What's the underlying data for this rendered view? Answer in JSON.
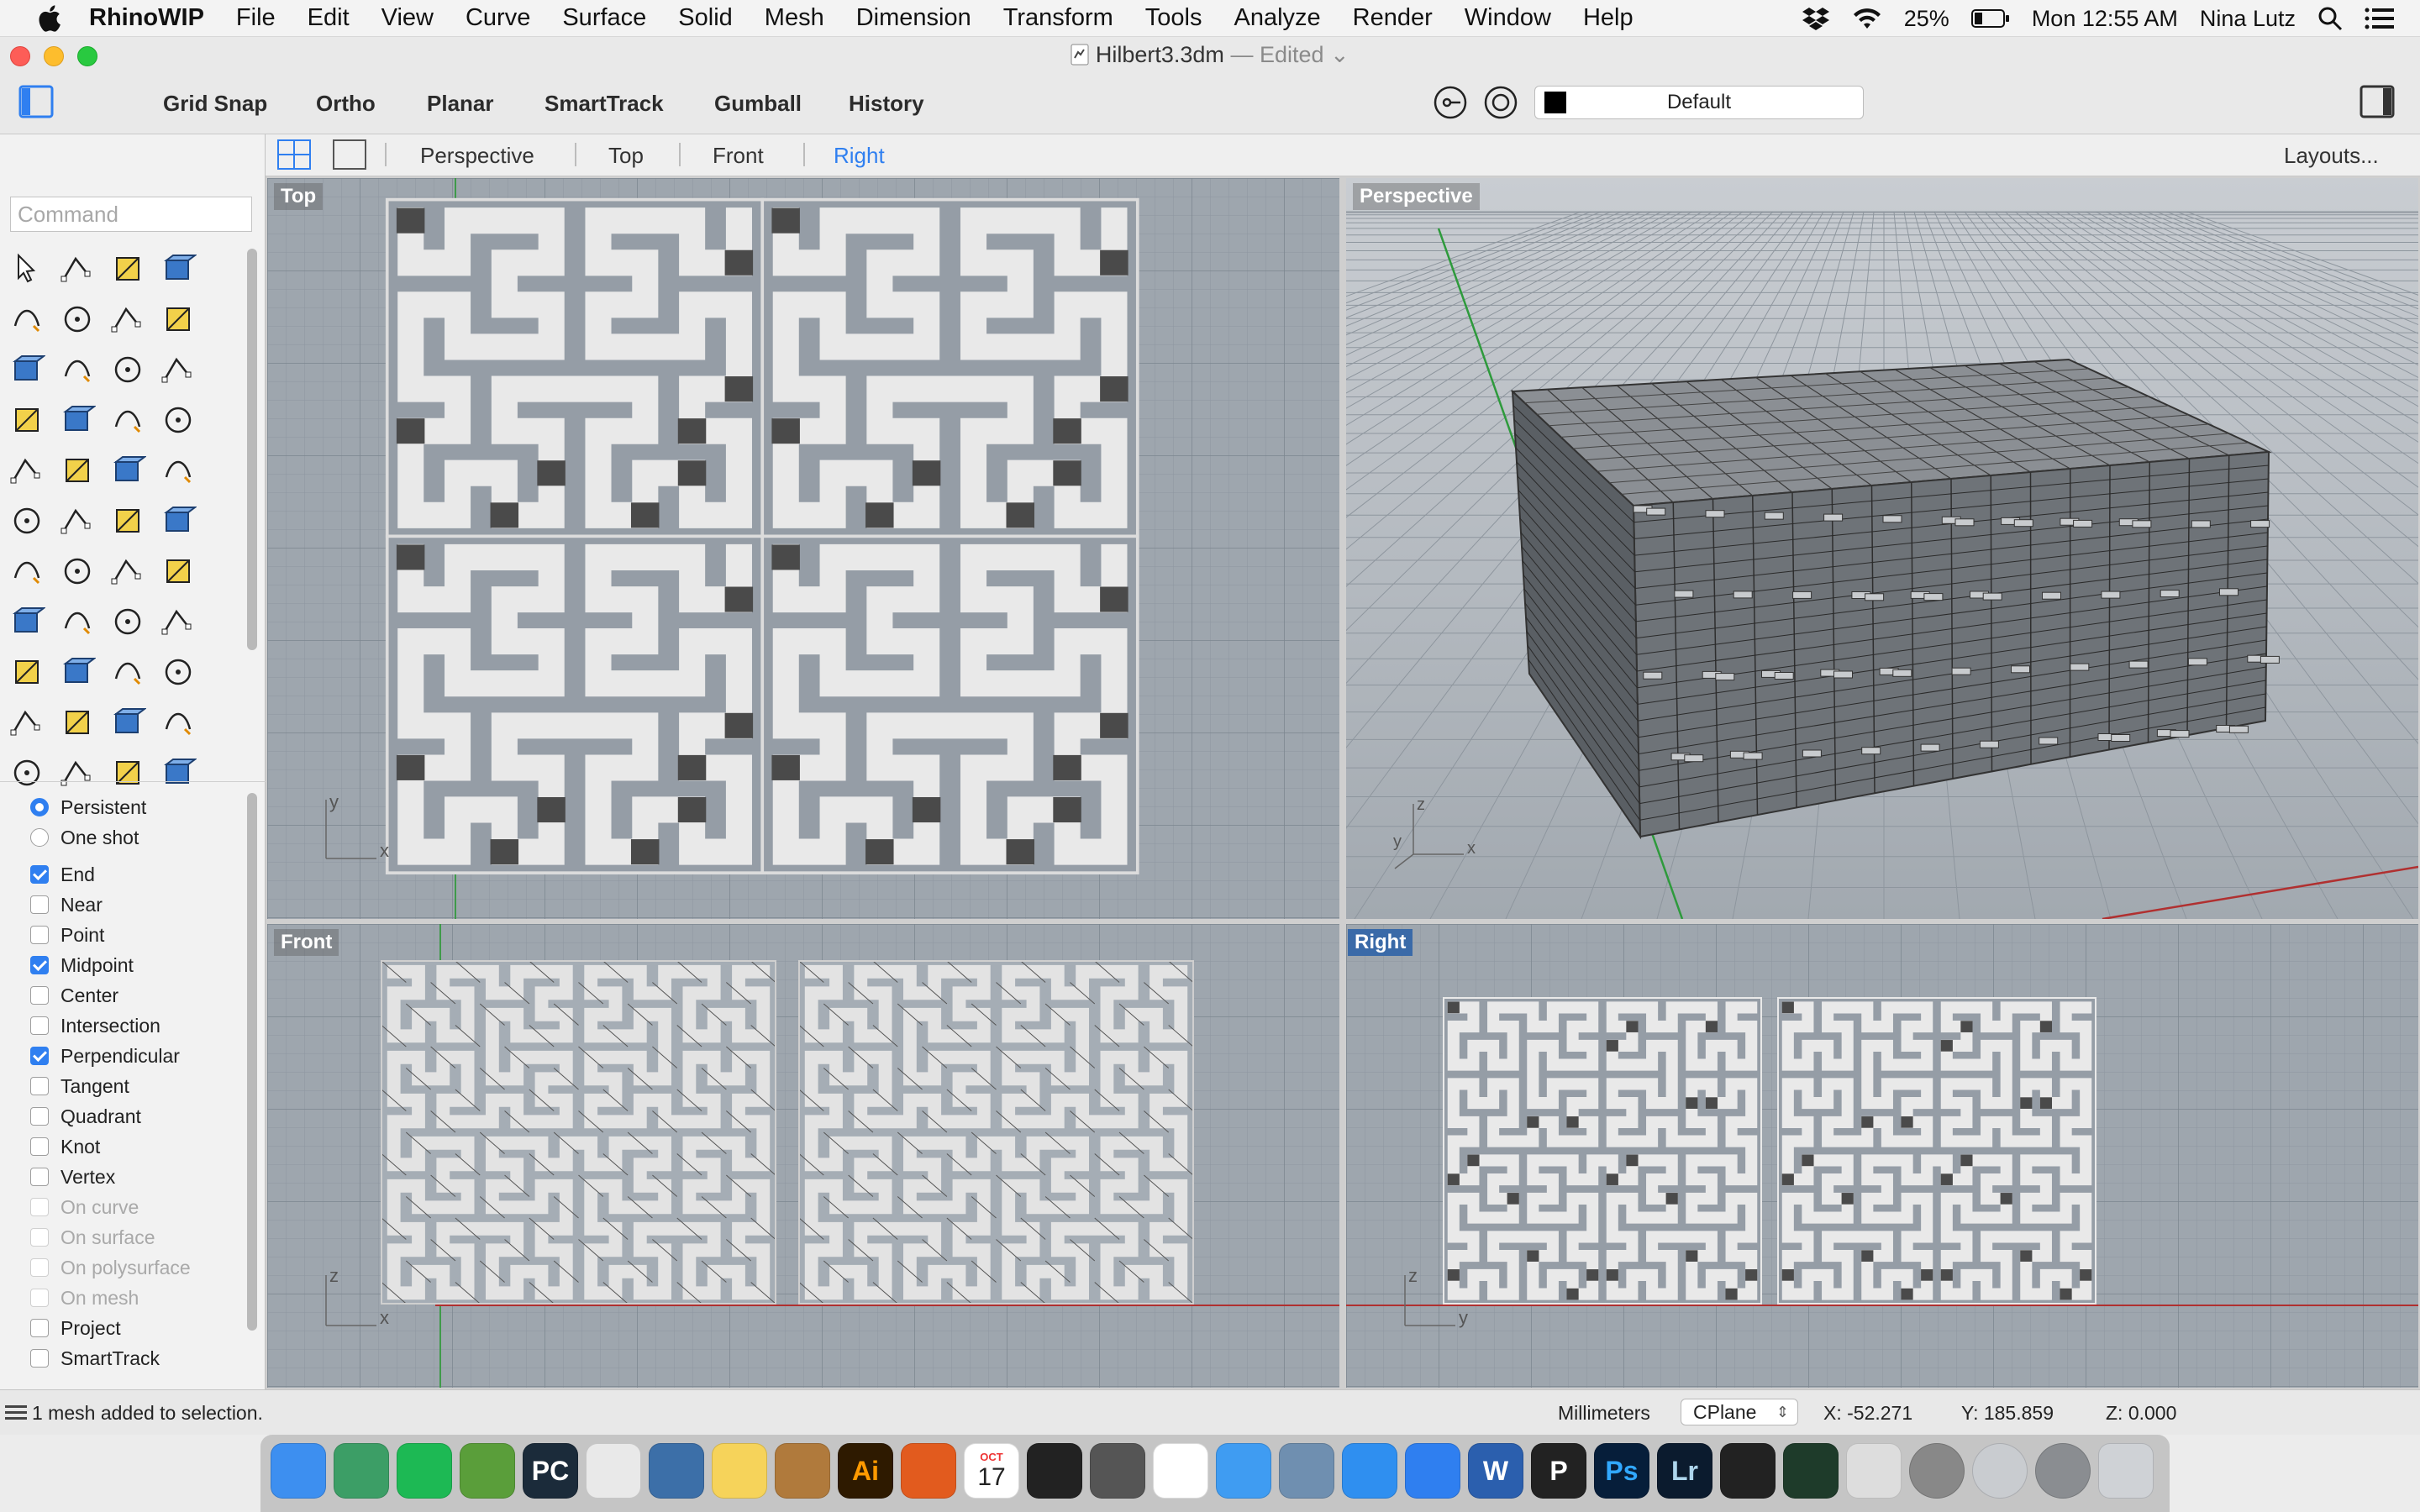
{
  "menubar": {
    "app": "RhinoWIP",
    "items": [
      "File",
      "Edit",
      "View",
      "Curve",
      "Surface",
      "Solid",
      "Mesh",
      "Dimension",
      "Transform",
      "Tools",
      "Analyze",
      "Render",
      "Window",
      "Help"
    ],
    "battery": "25%",
    "clock": "Mon 12:55 AM",
    "user": "Nina Lutz"
  },
  "window": {
    "title": "Hilbert3.3dm",
    "edited": "— Edited"
  },
  "toolbar": {
    "grid_snap": "Grid Snap",
    "ortho": "Ortho",
    "planar": "Planar",
    "smarttrack": "SmartTrack",
    "gumball": "Gumball",
    "history": "History",
    "layer": "Default"
  },
  "viewtabs": {
    "tabs": [
      "Perspective",
      "Top",
      "Front",
      "Right"
    ],
    "active": "Right",
    "layouts": "Layouts..."
  },
  "command": {
    "placeholder": "Command"
  },
  "osnap": {
    "mode": [
      {
        "label": "Persistent",
        "selected": true
      },
      {
        "label": "One shot",
        "selected": false
      }
    ],
    "items": [
      {
        "label": "End",
        "checked": true,
        "enabled": true
      },
      {
        "label": "Near",
        "checked": false,
        "enabled": true
      },
      {
        "label": "Point",
        "checked": false,
        "enabled": true
      },
      {
        "label": "Midpoint",
        "checked": true,
        "enabled": true
      },
      {
        "label": "Center",
        "checked": false,
        "enabled": true
      },
      {
        "label": "Intersection",
        "checked": false,
        "enabled": true
      },
      {
        "label": "Perpendicular",
        "checked": true,
        "enabled": true
      },
      {
        "label": "Tangent",
        "checked": false,
        "enabled": true
      },
      {
        "label": "Quadrant",
        "checked": false,
        "enabled": true
      },
      {
        "label": "Knot",
        "checked": false,
        "enabled": true
      },
      {
        "label": "Vertex",
        "checked": false,
        "enabled": true
      },
      {
        "label": "On curve",
        "checked": false,
        "enabled": false
      },
      {
        "label": "On surface",
        "checked": false,
        "enabled": false
      },
      {
        "label": "On polysurface",
        "checked": false,
        "enabled": false
      },
      {
        "label": "On mesh",
        "checked": false,
        "enabled": false
      },
      {
        "label": "Project",
        "checked": false,
        "enabled": true
      },
      {
        "label": "SmartTrack",
        "checked": false,
        "enabled": true
      }
    ]
  },
  "viewports": {
    "top": {
      "label": "Top",
      "axis_a": "y",
      "axis_b": "x"
    },
    "perspective": {
      "label": "Perspective",
      "axis_a": "z",
      "axis_b": "y",
      "axis_c": "x"
    },
    "front": {
      "label": "Front",
      "axis_a": "z",
      "axis_b": "x"
    },
    "right": {
      "label": "Right",
      "axis_a": "z",
      "axis_b": "y"
    }
  },
  "status": {
    "message": "1 mesh added to selection.",
    "units": "Millimeters",
    "cplane": "CPlane",
    "x": "X: -52.271",
    "y": "Y: 185.859",
    "z": "Z: 0.000"
  },
  "dock": {
    "apps": [
      "Finder",
      "Atom",
      "Spotify",
      "Evernote",
      "PyCharm",
      "Preview",
      "Python",
      "Notes",
      "Transmit",
      "Illustrator",
      "MATLAB",
      "Calendar",
      "GitHub",
      "Final Cut",
      "Photos",
      "Messages",
      "Mail Stamp",
      "Safari",
      "Dropbox",
      "Word",
      "Pages",
      "Photoshop",
      "Lightroom",
      "Processing",
      "Activity Monitor",
      "Rhino WIP",
      "Preview Scanner",
      "Launchpad",
      "System Preferences",
      "Trash"
    ],
    "calendar_month": "OCT",
    "calendar_day": "17",
    "ai_label": "Ai",
    "ps_label": "Ps",
    "lr_label": "Lr",
    "w_label": "W",
    "p_label": "P",
    "pc_label": "PC"
  },
  "colors": {
    "accent": "#2f7ff0",
    "viewport_bg": "#9aa3ad",
    "active_label": "#3a6aa8"
  }
}
